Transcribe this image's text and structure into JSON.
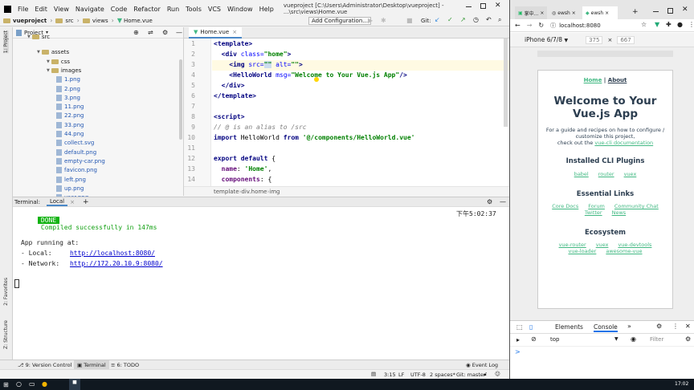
{
  "ide": {
    "menu": [
      "File",
      "Edit",
      "View",
      "Navigate",
      "Code",
      "Refactor",
      "Run",
      "Tools",
      "VCS",
      "Window",
      "Help"
    ],
    "title": "vueproject [C:\\Users\\Administrator\\Desktop\\vueproject] - ...\\src\\views\\Home.vue",
    "breadcrumb": [
      "vueproject",
      "src",
      "views",
      "Home.vue"
    ],
    "add_config": "Add Configuration...",
    "git_label": "Git:",
    "project_label": "Project",
    "side_tabs": {
      "project": "1: Project",
      "favorites": "2: Favorites",
      "structure": "Z: Structure"
    },
    "tree": [
      {
        "name": "src",
        "type": "folder",
        "indent": 0,
        "top": 0
      },
      {
        "name": "assets",
        "type": "folder",
        "indent": 1
      },
      {
        "name": "css",
        "type": "folder",
        "indent": 2
      },
      {
        "name": "images",
        "type": "folder",
        "indent": 2
      },
      {
        "name": "1.png",
        "type": "file",
        "indent": 3
      },
      {
        "name": "2.png",
        "type": "file",
        "indent": 3
      },
      {
        "name": "3.png",
        "type": "file",
        "indent": 3
      },
      {
        "name": "11.png",
        "type": "file",
        "indent": 3
      },
      {
        "name": "22.png",
        "type": "file",
        "indent": 3
      },
      {
        "name": "33.png",
        "type": "file",
        "indent": 3
      },
      {
        "name": "44.png",
        "type": "file",
        "indent": 3
      },
      {
        "name": "collect.svg",
        "type": "file",
        "indent": 3
      },
      {
        "name": "default.png",
        "type": "file",
        "indent": 3
      },
      {
        "name": "empty-car.png",
        "type": "file",
        "indent": 3
      },
      {
        "name": "favicon.png",
        "type": "file",
        "indent": 3
      },
      {
        "name": "left.png",
        "type": "file",
        "indent": 3
      },
      {
        "name": "up.png",
        "type": "file",
        "indent": 3
      },
      {
        "name": "user.png",
        "type": "file",
        "indent": 3
      }
    ],
    "editor_tab": "Home.vue",
    "line_numbers": [
      "1",
      "2",
      "3",
      "4",
      "5",
      "6",
      "7",
      "8",
      "9",
      "10",
      "11",
      "12",
      "13",
      "14"
    ],
    "code_breadcrumbs": [
      "template",
      "div.home",
      "img"
    ],
    "terminal": {
      "label": "Terminal:",
      "tab": "Local",
      "add": "+",
      "done_badge": "DONE",
      "compiled": "Compiled successfully in 147ms",
      "time": "下午5:02:37",
      "lines": [
        "App running at:",
        "- Local:   ",
        "- Network: "
      ],
      "local_url": "http://localhost:8080/",
      "network_url": "http://172.20.10.9:8080/"
    },
    "bottom_tabs": [
      "9: Version Control",
      "Terminal",
      "6: TODO"
    ],
    "event_log": "Event Log",
    "status": {
      "pos": "3:15",
      "sep": "LF",
      "enc": "UTF-8",
      "indent": "2 spaces*",
      "git": "Git: master"
    }
  },
  "browser": {
    "tabs": [
      "掌中...",
      "ewsh",
      "ewsh"
    ],
    "url": "localhost:8080",
    "device": "iPhone 6/7/8",
    "width": "375",
    "height": "667",
    "app": {
      "nav_home": "Home",
      "nav_sep": "|",
      "nav_about": "About",
      "heading": "Welcome to Your Vue.js App",
      "intro1": "For a guide and recipes on how to configure /",
      "intro2": "customize this project,",
      "intro3": "check out the",
      "intro_link": "vue-cli documentation",
      "h_plugins": "Installed CLI Plugins",
      "plugins": [
        "babel",
        "router",
        "vuex"
      ],
      "h_links": "Essential Links",
      "links": [
        "Core Docs",
        "Forum",
        "Community Chat",
        "Twitter",
        "News"
      ],
      "h_eco": "Ecosystem",
      "eco": [
        "vue-router",
        "vuex",
        "vue-devtools",
        "vue-loader",
        "awesome-vue"
      ]
    },
    "devtools": {
      "tabs": [
        "Elements",
        "Console"
      ],
      "more": "»",
      "context": "top",
      "filter": "Filter",
      "prompt": ">"
    }
  },
  "taskbar": {
    "time": "17:02"
  }
}
